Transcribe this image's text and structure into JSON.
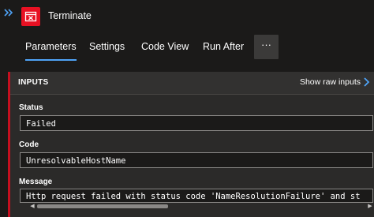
{
  "header": {
    "title": "Terminate",
    "expand_icon": "double-chevron-right-icon",
    "action_icon": "terminate-icon",
    "accent_color": "#e81123"
  },
  "tabs": [
    {
      "label": "Parameters",
      "active": true
    },
    {
      "label": "Settings",
      "active": false
    },
    {
      "label": "Code View",
      "active": false
    },
    {
      "label": "Run After",
      "active": false
    }
  ],
  "more_label": "···",
  "inputs": {
    "title": "INPUTS",
    "raw_link": "Show raw inputs",
    "fields": [
      {
        "label": "Status",
        "value": "Failed"
      },
      {
        "label": "Code",
        "value": "UnresolvableHostName"
      },
      {
        "label": "Message",
        "value": "Http request failed with status code 'NameResolutionFailure' and st"
      }
    ]
  },
  "colors": {
    "background": "#1b1a19",
    "panel": "#2b2a29",
    "error_bar": "#c50f1f",
    "link_accent": "#4fa3f7"
  }
}
